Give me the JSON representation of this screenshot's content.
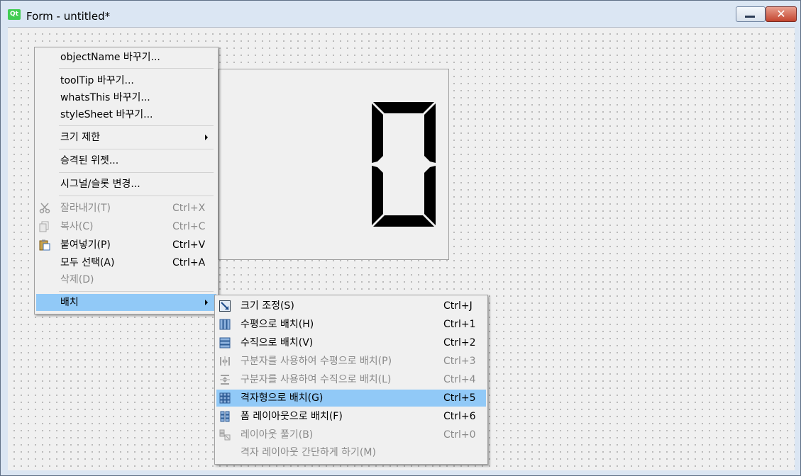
{
  "window": {
    "title": "Form - untitled*",
    "close_glyph": "✕",
    "logo_text": "Qt"
  },
  "context_menu": {
    "items": [
      {
        "label": "objectName 바꾸기..."
      },
      {
        "label": "toolTip 바꾸기..."
      },
      {
        "label": "whatsThis 바꾸기..."
      },
      {
        "label": "styleSheet 바꾸기..."
      },
      {
        "label": "크기 제한"
      },
      {
        "label": "승격된 위젯..."
      },
      {
        "label": "시그널/슬롯 변경..."
      },
      {
        "label": "잘라내기(T)",
        "shortcut": "Ctrl+X",
        "icon": "scissors-icon"
      },
      {
        "label": "복사(C)",
        "shortcut": "Ctrl+C",
        "icon": "copy-icon"
      },
      {
        "label": "붙여넣기(P)",
        "shortcut": "Ctrl+V",
        "icon": "paste-icon"
      },
      {
        "label": "모두 선택(A)",
        "shortcut": "Ctrl+A"
      },
      {
        "label": "삭제(D)"
      },
      {
        "label": "배치"
      }
    ]
  },
  "layout_submenu": {
    "items": [
      {
        "label": "크기 조정(S)",
        "shortcut": "Ctrl+J",
        "icon": "adjust-size-icon"
      },
      {
        "label": "수평으로 배치(H)",
        "shortcut": "Ctrl+1",
        "icon": "horizontal-layout-icon"
      },
      {
        "label": "수직으로 배치(V)",
        "shortcut": "Ctrl+2",
        "icon": "vertical-layout-icon"
      },
      {
        "label": "구분자를 사용하여 수평으로 배치(P)",
        "shortcut": "Ctrl+3",
        "icon": "horizontal-splitter-icon"
      },
      {
        "label": "구분자를 사용하여 수직으로 배치(L)",
        "shortcut": "Ctrl+4",
        "icon": "vertical-splitter-icon"
      },
      {
        "label": "격자형으로 배치(G)",
        "shortcut": "Ctrl+5",
        "icon": "grid-layout-icon"
      },
      {
        "label": "폼 레이아웃으로 배치(F)",
        "shortcut": "Ctrl+6",
        "icon": "form-layout-icon"
      },
      {
        "label": "레이아웃 풀기(B)",
        "shortcut": "Ctrl+0",
        "icon": "break-layout-icon"
      },
      {
        "label": "격자 레이아웃 간단하게 하기(M)"
      }
    ]
  },
  "lcd_widget": {
    "digit": "0"
  },
  "colors": {
    "highlight": "#91c9f7",
    "qt_green": "#41cd52",
    "disabled_text": "#8a8a8a"
  }
}
